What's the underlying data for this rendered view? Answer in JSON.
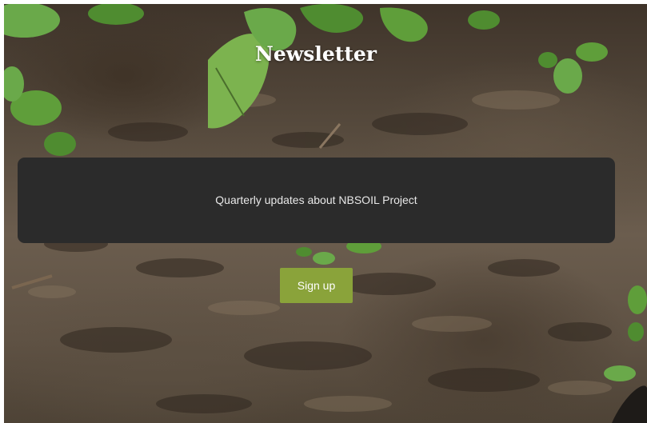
{
  "newsletter": {
    "title": "Newsletter",
    "description": "Quarterly updates about NBSOIL Project",
    "signup_label": "Sign up"
  },
  "colors": {
    "panel": "#2b2b2b",
    "button": "#8aa33a",
    "leaf": "#5f9e3a"
  },
  "background": {
    "image": "soil-with-seedlings-photo"
  }
}
